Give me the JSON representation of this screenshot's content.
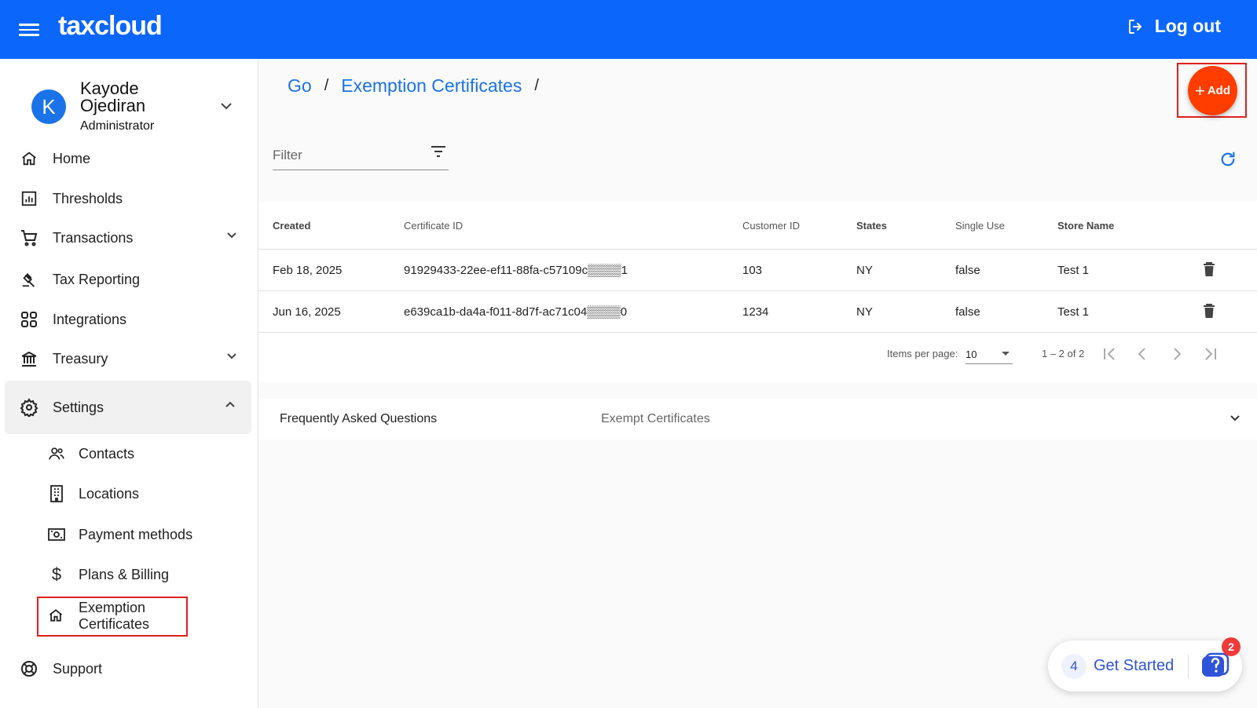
{
  "header": {
    "logo": "taxcloud",
    "logout_label": "Log out"
  },
  "profile": {
    "initial": "K",
    "name": "Kayode Ojediran",
    "role": "Administrator"
  },
  "nav": {
    "home": "Home",
    "thresholds": "Thresholds",
    "transactions": "Transactions",
    "tax_reporting": "Tax Reporting",
    "integrations": "Integrations",
    "treasury": "Treasury",
    "settings": "Settings",
    "support": "Support"
  },
  "settings_sub": {
    "contacts": "Contacts",
    "locations": "Locations",
    "payment_methods": "Payment methods",
    "plans_billing": "Plans & Billing",
    "exemption_line1": "Exemption",
    "exemption_line2": "Certificates"
  },
  "breadcrumb": {
    "root": "Go",
    "current": "Exemption Certificates",
    "sep": "/"
  },
  "add_button": {
    "label": "Add",
    "plus": "+"
  },
  "filter": {
    "placeholder": "Filter"
  },
  "table": {
    "headers": {
      "created": "Created",
      "certificate_id": "Certificate ID",
      "customer_id": "Customer ID",
      "states": "States",
      "single_use": "Single Use",
      "store_name": "Store Name"
    },
    "rows": [
      {
        "created": "Feb 18, 2025",
        "certificate_id": "91929433-22ee-ef11-88fa-c57109c▒▒▒▒1",
        "customer_id": "103",
        "states": "NY",
        "single_use": "false",
        "store_name": "Test 1"
      },
      {
        "created": "Jun 16, 2025",
        "certificate_id": "e639ca1b-da4a-f011-8d7f-ac71c04▒▒▒▒0",
        "customer_id": "1234",
        "states": "NY",
        "single_use": "false",
        "store_name": "Test 1"
      }
    ]
  },
  "pagination": {
    "items_per_page_label": "Items per page:",
    "items_per_page": "10",
    "range": "1 – 2 of 2"
  },
  "faq": {
    "title": "Frequently Asked Questions",
    "topic": "Exempt Certificates"
  },
  "get_started": {
    "count": "4",
    "label": "Get Started",
    "badge": "2"
  },
  "colors": {
    "brand": "#0b66fb",
    "accent": "#ff3d00",
    "link": "#1a73e8",
    "highlight": "#e02020"
  }
}
